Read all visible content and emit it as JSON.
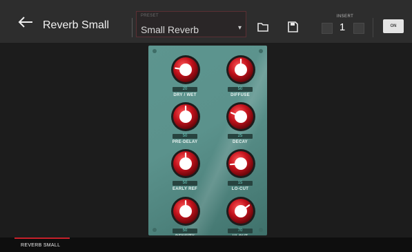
{
  "header": {
    "title": "Reverb Small",
    "preset_caption": "PRESET",
    "preset_value": "Small Reverb",
    "insert_caption": "INSERT",
    "insert_number": "1",
    "on_label": "ON"
  },
  "knobs": [
    {
      "label": "DRY / WET",
      "value": "20",
      "level": 0.2
    },
    {
      "label": "DIFFUSE",
      "value": "50",
      "level": 0.5
    },
    {
      "label": "PRE-DELAY",
      "value": "50",
      "level": 0.5
    },
    {
      "label": "DECAY",
      "value": "25",
      "level": 0.25
    },
    {
      "label": "EARLY REF",
      "value": "50",
      "level": 0.5
    },
    {
      "label": "LO-CUT",
      "value": "15",
      "level": 0.15
    },
    {
      "label": "DENSITY",
      "value": "50",
      "level": 0.5
    },
    {
      "label": "HI-CUT",
      "value": "70",
      "level": 0.7
    }
  ],
  "footer": {
    "tab_label": "REVERB SMALL"
  },
  "colors": {
    "accent": "#c8202a",
    "panel": "#5b928c",
    "readout": "#6fd5c8"
  }
}
